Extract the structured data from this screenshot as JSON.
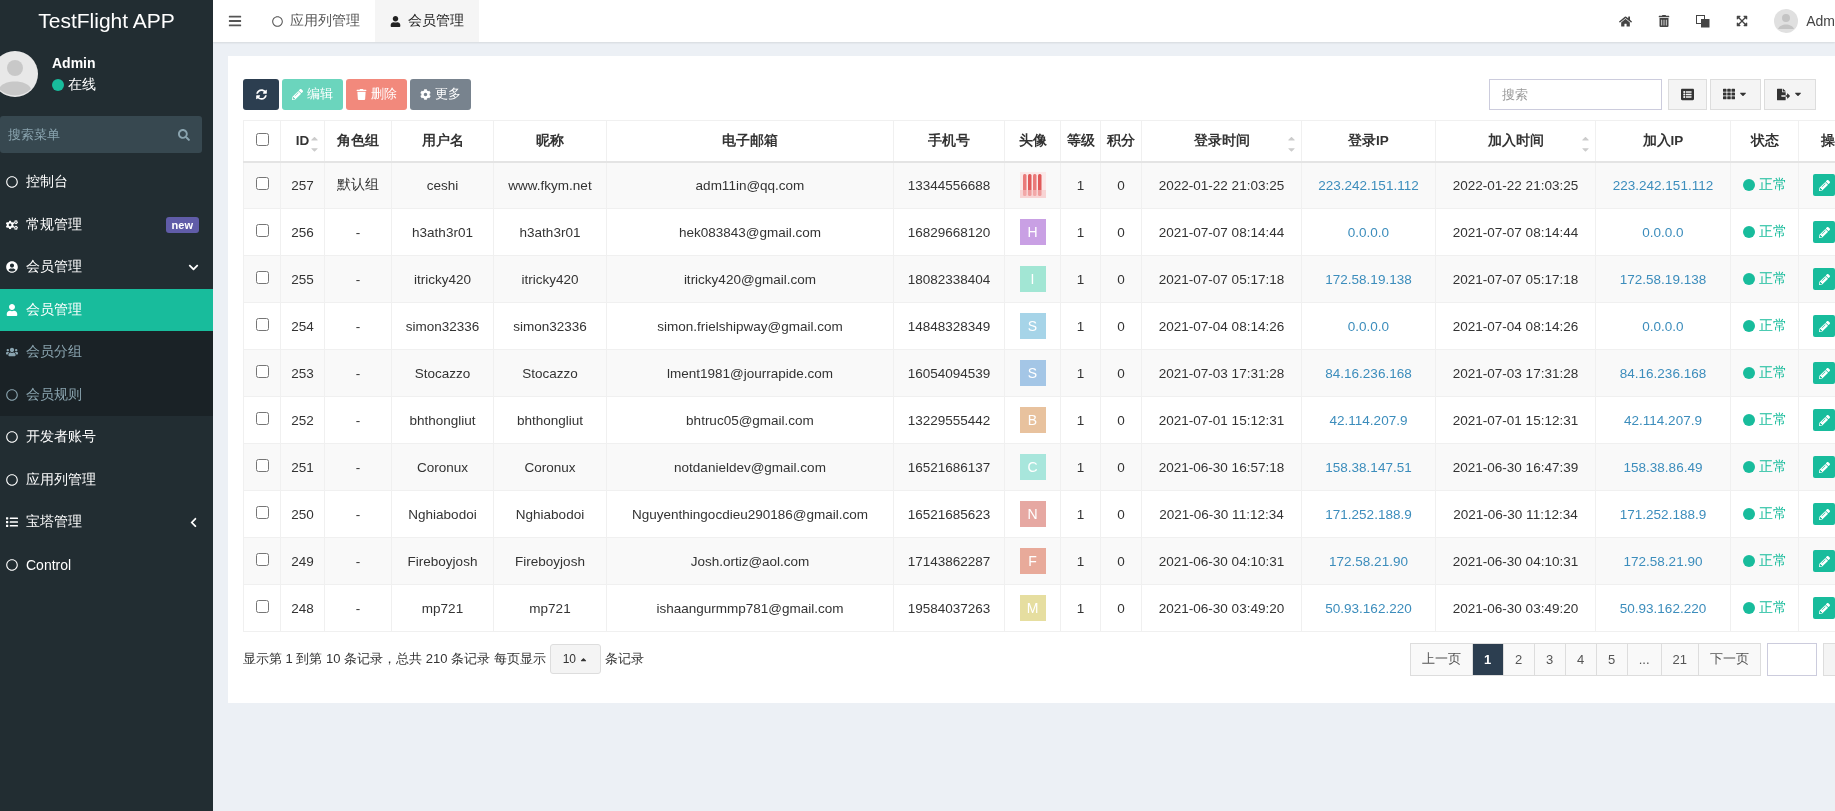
{
  "brand": "TestFlight APP",
  "user": {
    "name": "Admin",
    "status": "在线"
  },
  "menu_search": {
    "placeholder": "搜索菜单"
  },
  "menu": [
    {
      "label": "控制台",
      "selected": false
    },
    {
      "label": "常规管理",
      "selected": false,
      "badge": "new"
    },
    {
      "label": "会员管理",
      "selected": false,
      "expanded": true,
      "children": [
        {
          "label": "会员管理",
          "selected": true
        },
        {
          "label": "会员分组",
          "selected": false
        },
        {
          "label": "会员规则",
          "selected": false
        }
      ]
    },
    {
      "label": "开发者账号",
      "selected": false
    },
    {
      "label": "应用列管理",
      "selected": false
    },
    {
      "label": "宝塔管理",
      "selected": false,
      "expanded": false
    },
    {
      "label": "Control",
      "selected": false
    }
  ],
  "tabs": [
    {
      "label": "应用列管理",
      "selected": false
    },
    {
      "label": "会员管理",
      "selected": true
    }
  ],
  "top_user": "Adm",
  "toolbar": {
    "buttons": [
      {
        "kind": "refresh"
      },
      {
        "kind": "edit",
        "label": "编辑"
      },
      {
        "kind": "delete",
        "label": "删除"
      },
      {
        "kind": "more",
        "label": "更多"
      }
    ],
    "search": {
      "placeholder": "搜索"
    }
  },
  "table": {
    "all_checked": false,
    "columns": [
      {
        "label": "ID",
        "sortable": true
      },
      {
        "label": "角色组",
        "sortable": false
      },
      {
        "label": "用户名",
        "sortable": false
      },
      {
        "label": "昵称",
        "sortable": false
      },
      {
        "label": "电子邮箱",
        "sortable": false
      },
      {
        "label": "手机号",
        "sortable": false
      },
      {
        "label": "头像",
        "sortable": false
      },
      {
        "label": "等级",
        "sortable": false
      },
      {
        "label": "积分",
        "sortable": false
      },
      {
        "label": "登录时间",
        "sortable": true
      },
      {
        "label": "登录IP",
        "sortable": false
      },
      {
        "label": "加入时间",
        "sortable": true
      },
      {
        "label": "加入IP",
        "sortable": false
      },
      {
        "label": "状态",
        "sortable": false
      },
      {
        "label": "操",
        "sortable": false
      }
    ],
    "rows": [
      {
        "checked": false,
        "id": "257",
        "group": "默认组",
        "username": "ceshi",
        "nickname": "www.fkym.net",
        "email": "adm11in@qq.com",
        "phone": "13344556688",
        "level": "1",
        "score": "0",
        "login_time": "2022-01-22 21:03:25",
        "login_ip": "223.242.151.112",
        "join_time": "2022-01-22 21:03:25",
        "join_ip": "223.242.151.112",
        "status": "正常"
      },
      {
        "checked": false,
        "id": "256",
        "group": "-",
        "username": "h3ath3r01",
        "nickname": "h3ath3r01",
        "email": "hek083843@gmail.com",
        "phone": "16829668120",
        "avatar": {
          "kind": "letter",
          "letter": "H",
          "color": "#c9a0e4"
        },
        "level": "1",
        "score": "0",
        "login_time": "2021-07-07 08:14:44",
        "login_ip": "0.0.0.0",
        "join_time": "2021-07-07 08:14:44",
        "join_ip": "0.0.0.0",
        "status": "正常"
      },
      {
        "checked": false,
        "id": "255",
        "group": "-",
        "username": "itricky420",
        "nickname": "itricky420",
        "email": "itricky420@gmail.com",
        "phone": "18082338404",
        "avatar": {
          "kind": "letter",
          "letter": "I",
          "color": "#a2e6d4"
        },
        "level": "1",
        "score": "0",
        "login_time": "2021-07-07 05:17:18",
        "login_ip": "172.58.19.138",
        "join_time": "2021-07-07 05:17:18",
        "join_ip": "172.58.19.138",
        "status": "正常"
      },
      {
        "checked": false,
        "id": "254",
        "group": "-",
        "username": "simon32336",
        "nickname": "simon32336",
        "email": "simon.frielshipway@gmail.com",
        "phone": "14848328349",
        "avatar": {
          "kind": "letter",
          "letter": "S",
          "color": "#a6d4e8"
        },
        "level": "1",
        "score": "0",
        "login_time": "2021-07-04 08:14:26",
        "login_ip": "0.0.0.0",
        "join_time": "2021-07-04 08:14:26",
        "join_ip": "0.0.0.0",
        "status": "正常"
      },
      {
        "checked": false,
        "id": "253",
        "group": "-",
        "username": "Stocazzo",
        "nickname": "Stocazzo",
        "email": "lment1981@jourrapide.com",
        "phone": "16054094539",
        "avatar": {
          "kind": "letter",
          "letter": "S",
          "color": "#a4c6e6"
        },
        "level": "1",
        "score": "0",
        "login_time": "2021-07-03 17:31:28",
        "login_ip": "84.16.236.168",
        "join_time": "2021-07-03 17:31:28",
        "join_ip": "84.16.236.168",
        "status": "正常"
      },
      {
        "checked": false,
        "id": "252",
        "group": "-",
        "username": "bhthongliut",
        "nickname": "bhthongliut",
        "email": "bhtruc05@gmail.com",
        "phone": "13229555442",
        "avatar": {
          "kind": "letter",
          "letter": "B",
          "color": "#e8c29e"
        },
        "level": "1",
        "score": "0",
        "login_time": "2021-07-01 15:12:31",
        "login_ip": "42.114.207.9",
        "join_time": "2021-07-01 15:12:31",
        "join_ip": "42.114.207.9",
        "status": "正常"
      },
      {
        "checked": false,
        "id": "251",
        "group": "-",
        "username": "Coronux",
        "nickname": "Coronux",
        "email": "notdanieldev@gmail.com",
        "phone": "16521686137",
        "avatar": {
          "kind": "letter",
          "letter": "C",
          "color": "#a8e6dc"
        },
        "level": "1",
        "score": "0",
        "login_time": "2021-06-30 16:57:18",
        "login_ip": "158.38.147.51",
        "join_time": "2021-06-30 16:47:39",
        "join_ip": "158.38.86.49",
        "status": "正常"
      },
      {
        "checked": false,
        "id": "250",
        "group": "-",
        "username": "Nghiabodoi",
        "nickname": "Nghiabodoi",
        "email": "Nguyenthingocdieu290186@gmail.com",
        "phone": "16521685623",
        "avatar": {
          "kind": "letter",
          "letter": "N",
          "color": "#e6a8a2"
        },
        "level": "1",
        "score": "0",
        "login_time": "2021-06-30 11:12:34",
        "login_ip": "171.252.188.9",
        "join_time": "2021-06-30 11:12:34",
        "join_ip": "171.252.188.9",
        "status": "正常"
      },
      {
        "checked": false,
        "id": "249",
        "group": "-",
        "username": "Fireboyjosh",
        "nickname": "Fireboyjosh",
        "email": "Josh.ortiz@aol.com",
        "phone": "17143862287",
        "avatar": {
          "kind": "letter",
          "letter": "F",
          "color": "#e8aa9a"
        },
        "level": "1",
        "score": "0",
        "login_time": "2021-06-30 04:10:31",
        "login_ip": "172.58.21.90",
        "join_time": "2021-06-30 04:10:31",
        "join_ip": "172.58.21.90",
        "status": "正常"
      },
      {
        "checked": false,
        "id": "248",
        "group": "-",
        "username": "mp721",
        "nickname": "mp721",
        "email": "ishaangurmmp781@gmail.com",
        "phone": "19584037263",
        "avatar": {
          "kind": "letter",
          "letter": "M",
          "color": "#e6dea0"
        },
        "level": "1",
        "score": "0",
        "login_time": "2021-06-30 03:49:20",
        "login_ip": "50.93.162.220",
        "join_time": "2021-06-30 03:49:20",
        "join_ip": "50.93.162.220",
        "status": "正常"
      }
    ]
  },
  "footer": {
    "summary": "显示第 1 到第 10 条记录，总共 210 条记录 每页显示",
    "page_size": "10",
    "suffix": "条记录"
  },
  "pagination": [
    {
      "label": "上一页",
      "selected": false
    },
    {
      "label": "1",
      "selected": true
    },
    {
      "label": "2",
      "selected": false
    },
    {
      "label": "3",
      "selected": false
    },
    {
      "label": "4",
      "selected": false
    },
    {
      "label": "5",
      "selected": false
    },
    {
      "label": "...",
      "selected": false
    },
    {
      "label": "21",
      "selected": false
    },
    {
      "label": "下一页",
      "selected": false
    }
  ]
}
